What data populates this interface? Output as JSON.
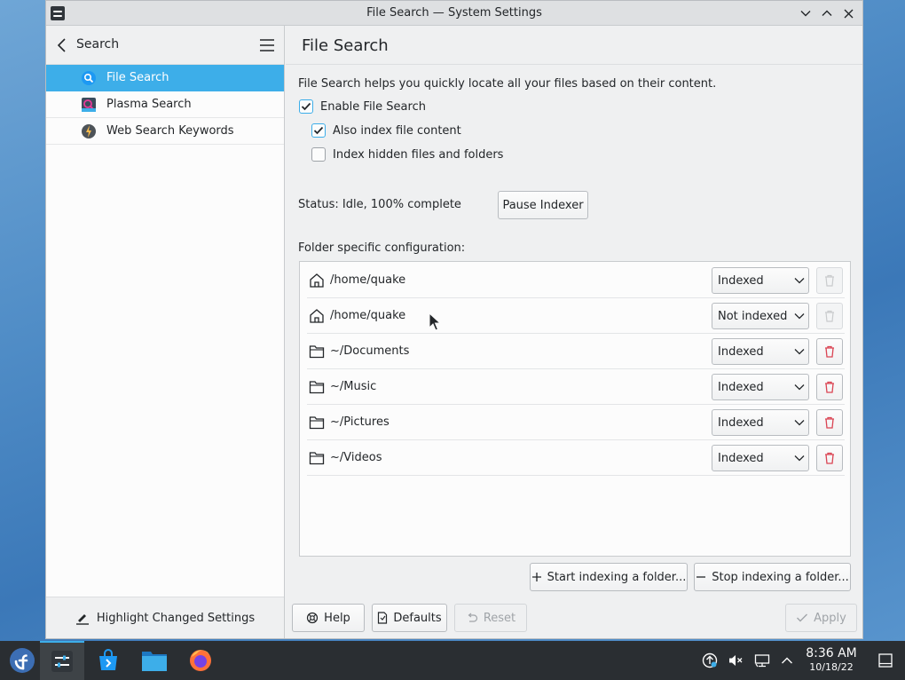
{
  "window": {
    "title": "File Search — System Settings"
  },
  "sidebar": {
    "title": "Search",
    "items": [
      {
        "label": "File Search",
        "icon": "file-search-icon",
        "active": true
      },
      {
        "label": "Plasma Search",
        "icon": "plasma-search-icon",
        "active": false
      },
      {
        "label": "Web Search Keywords",
        "icon": "web-search-keywords-icon",
        "active": false
      }
    ],
    "footer_label": "Highlight Changed Settings"
  },
  "main": {
    "title": "File Search",
    "description": "File Search helps you quickly locate all your files based on their content.",
    "enable_label": "Enable File Search",
    "enable_checked": true,
    "index_content_label": "Also index file content",
    "index_content_checked": true,
    "index_hidden_label": "Index hidden files and folders",
    "index_hidden_checked": false,
    "status_text": "Status: Idle, 100% complete",
    "pause_label": "Pause Indexer",
    "folder_config_label": "Folder specific configuration:",
    "folders": [
      {
        "path": "/home/quake",
        "icon": "home-folder-icon",
        "state": "Indexed",
        "deletable": false
      },
      {
        "path": "/home/quake",
        "icon": "home-folder-icon",
        "state": "Not indexed",
        "deletable": false
      },
      {
        "path": "~/Documents",
        "icon": "folder-icon",
        "state": "Indexed",
        "deletable": true
      },
      {
        "path": "~/Music",
        "icon": "folder-icon",
        "state": "Indexed",
        "deletable": true
      },
      {
        "path": "~/Pictures",
        "icon": "folder-icon",
        "state": "Indexed",
        "deletable": true
      },
      {
        "path": "~/Videos",
        "icon": "folder-icon",
        "state": "Indexed",
        "deletable": true
      }
    ],
    "start_indexing_label": "Start indexing a folder...",
    "stop_indexing_label": "Stop indexing a folder..."
  },
  "bottom": {
    "help_label": "Help",
    "defaults_label": "Defaults",
    "reset_label": "Reset",
    "apply_label": "Apply"
  },
  "taskbar": {
    "time": "8:36 AM",
    "date": "10/18/22"
  },
  "colors": {
    "accent": "#3daee9",
    "delete_red": "#da4453",
    "taskbar": "#2a2e32"
  }
}
